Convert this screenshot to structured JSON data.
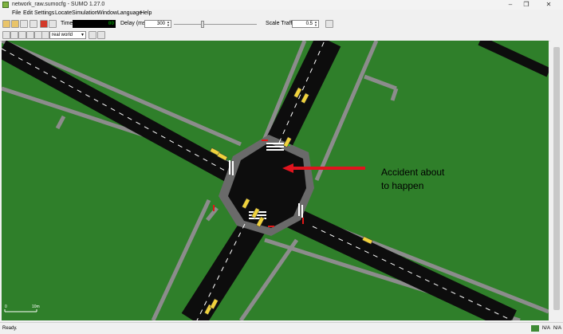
{
  "window": {
    "title": "network_raw.sumocfg - SUMO 1.27.0"
  },
  "window_controls": {
    "minimize": "–",
    "maximize": "❐",
    "close": "✕"
  },
  "menu": [
    "File",
    "Edit",
    "Settings",
    "Locate",
    "Simulation",
    "Window",
    "Language",
    "Help"
  ],
  "toolbar": {
    "time_label": "Time:",
    "time_value": "00",
    "delay_label": "Delay (ms):",
    "delay_value": "300",
    "scale_label": "Scale Traffic:",
    "scale_value": "0.5"
  },
  "view_toolbar": {
    "viewport_select": "real world"
  },
  "scale_bar": {
    "start": "0",
    "end": "10m"
  },
  "annotation": {
    "line1": "Accident about",
    "line2": "to happen",
    "arrow_color": "#e0141e"
  },
  "status": {
    "text": "Ready.",
    "na1": "N/A",
    "na2": "N/A"
  },
  "colors": {
    "grass": "#2f7f2a",
    "road": "#0d0d0d",
    "sidewalk": "#8c8c8c",
    "vehicle": "#f0d23c"
  }
}
